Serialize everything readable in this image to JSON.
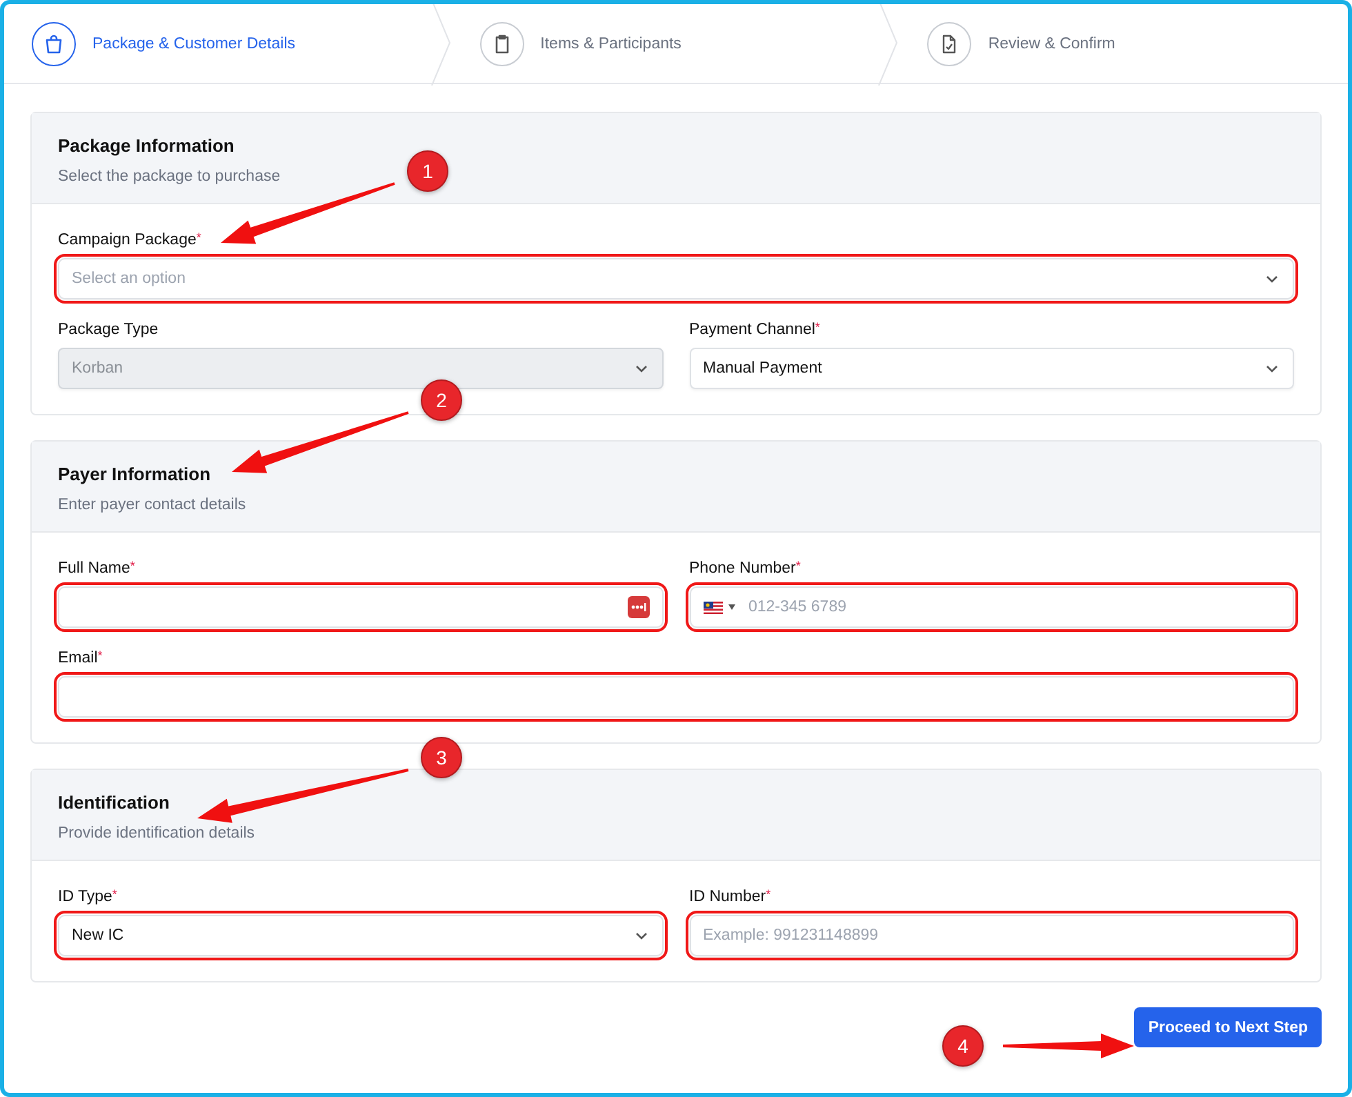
{
  "steps": [
    {
      "label": "Package & Customer Details",
      "selected": true
    },
    {
      "label": "Items & Participants",
      "selected": false
    },
    {
      "label": "Review & Confirm",
      "selected": false
    }
  ],
  "sections": [
    {
      "title": "Package Information",
      "subtitle": "Select the package to purchase",
      "rows": [
        [
          {
            "label": "Campaign Package",
            "required_mark": "*",
            "kind": "select",
            "placeholder": "Select an option",
            "disabled": false,
            "highlighted": true
          }
        ],
        [
          {
            "label": "Package Type",
            "kind": "select",
            "value": "Korban",
            "disabled": true,
            "highlighted": false
          },
          {
            "label": "Payment Channel",
            "required_mark": "*",
            "kind": "select",
            "value": "Manual Payment",
            "disabled": false,
            "highlighted": false
          }
        ]
      ]
    },
    {
      "title": "Payer Information",
      "subtitle": "Enter payer contact details",
      "rows": [
        [
          {
            "label": "Full Name",
            "required_mark": "*",
            "kind": "input",
            "autofill": true,
            "disabled": false,
            "highlighted": true
          },
          {
            "label": "Phone Number",
            "required_mark": "*",
            "kind": "phone",
            "placeholder": "012-345 6789",
            "disabled": false,
            "highlighted": true
          }
        ],
        [
          {
            "label": "Email",
            "required_mark": "*",
            "kind": "input",
            "disabled": false,
            "highlighted": true
          }
        ]
      ]
    },
    {
      "title": "Identification",
      "subtitle": "Provide identification details",
      "rows": [
        [
          {
            "label": "ID Type",
            "required_mark": "*",
            "kind": "select",
            "value": "New IC",
            "disabled": false,
            "highlighted": true
          },
          {
            "label": "ID Number",
            "required_mark": "*",
            "kind": "input",
            "placeholder": "Example: 991231148899",
            "disabled": false,
            "highlighted": true
          }
        ]
      ]
    }
  ],
  "callouts": [
    {
      "number": "1"
    },
    {
      "number": "2"
    },
    {
      "number": "3"
    },
    {
      "number": "4"
    }
  ],
  "button": {
    "label": "Proceed to Next Step"
  }
}
